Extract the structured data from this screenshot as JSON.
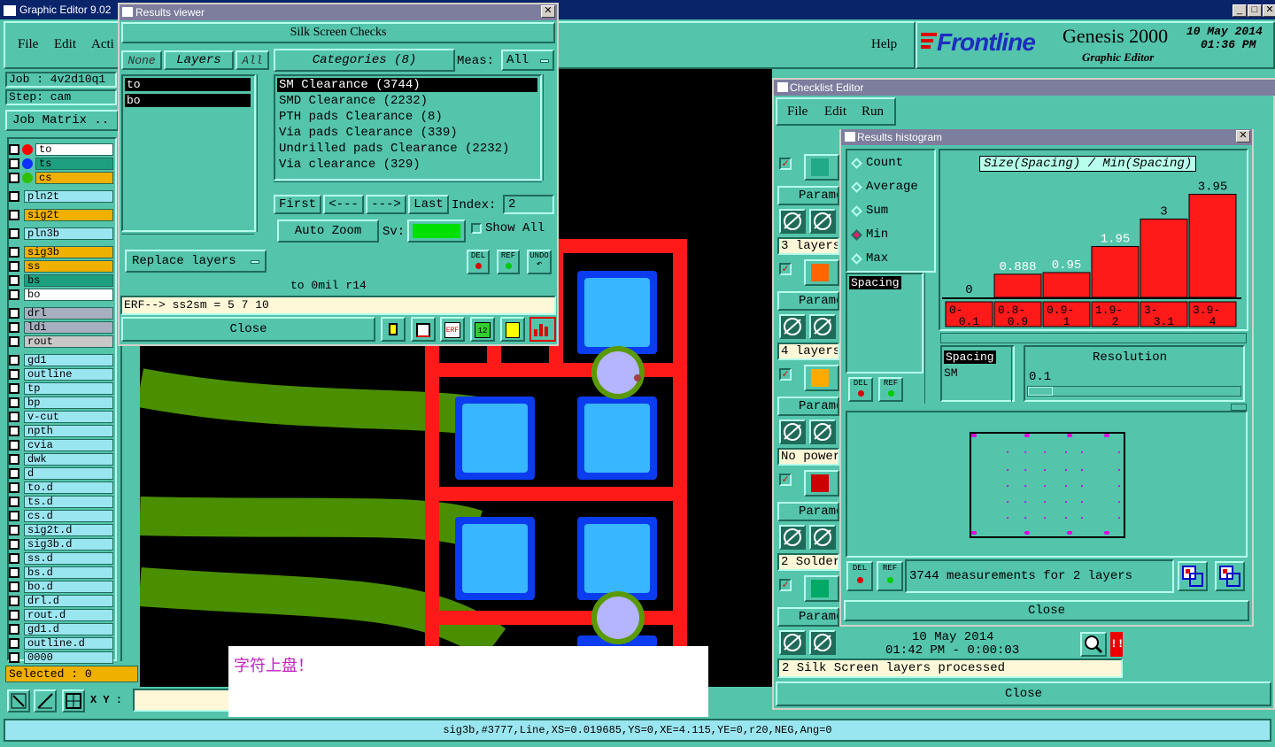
{
  "ge": {
    "title": "Graphic Editor 9.02",
    "menu": [
      "File",
      "Edit",
      "Acti"
    ],
    "help": "Help",
    "job_label": "Job : 4v2d10q1",
    "step_label": "Step: cam",
    "job_matrix": "Job Matrix ..",
    "brand": "Frontline",
    "product": "Genesis 2000",
    "product_sub": "Graphic Editor",
    "date": "10 May 2014",
    "time": "01:36 PM",
    "selected": "Selected : 0",
    "xy_label": "X Y :",
    "status_bar": "sig3b,#3777,Line,XS=0.019685,YS=0,XE=4.115,YE=0,r20,NEG,Ang=0",
    "layers": [
      "to",
      "ts",
      "cs",
      "pln2t",
      "sig2t",
      "pln3b",
      "sig3b",
      "ss",
      "bs",
      "bo",
      "drl",
      "ldi",
      "rout",
      "gd1",
      "outline",
      "tp",
      "bp",
      "v-cut",
      "npth",
      "cvia",
      "dwk",
      "d",
      "to.d",
      "ts.d",
      "cs.d",
      "sig2t.d",
      "sig3b.d",
      "ss.d",
      "bs.d",
      "bo.d",
      "drl.d",
      "rout.d",
      "gd1.d",
      "outline.d",
      "0000"
    ],
    "note": "字符上盘！"
  },
  "rv": {
    "title": "Results viewer",
    "header": "Silk Screen Checks",
    "none": "None",
    "layers_label": "Layers",
    "all": "All",
    "categories": "Categories (8)",
    "meas_label": "Meas:",
    "meas_value": "All",
    "layer_list": [
      "to",
      "bo"
    ],
    "category_list": [
      "SM Clearance (3744)",
      "SMD Clearance (2232)",
      "PTH pads Clearance (8)",
      "Via pads Clearance (339)",
      "Undrilled pads Clearance (2232)",
      "Via clearance (329)"
    ],
    "first": "First",
    "prev": "<---",
    "next": "--->",
    "last": "Last",
    "index_label": "Index:",
    "index_value": "2",
    "auto_zoom": "Auto Zoom",
    "sv_label": "Sv:",
    "show_all": "Show All",
    "replace_layers": "Replace layers",
    "del": "DEL",
    "ref": "REF",
    "undo": "UNDO",
    "info_line": "to  0mil   r14",
    "erf_line": "ERF--> ss2sm = 5 7 10",
    "close": "Close"
  },
  "ce": {
    "title": "Checklist Editor",
    "menu": [
      "File",
      "Edit",
      "Run"
    ],
    "param": "Parame",
    "rows": [
      "3 layers",
      "4 layers",
      "No power",
      "2 Solder",
      "2 Silk Screen layers processed"
    ],
    "date": "10 May 2014",
    "time_line": "01:42 PM - 0:00:03",
    "close": "Close"
  },
  "rh": {
    "title": "Results histogram",
    "options": [
      "Count",
      "Average",
      "Sum",
      "Min",
      "Max"
    ],
    "selected_option": "Min",
    "list_item": "Spacing",
    "res_list": [
      "Spacing",
      "SM"
    ],
    "resolution_label": "Resolution",
    "resolution_value": "0.1",
    "summary": "3744 measurements for 2 layers",
    "close": "Close",
    "del": "DEL",
    "ref": "REF"
  },
  "chart_data": {
    "type": "bar",
    "title": "Size(Spacing) / Min(Spacing)",
    "categories": [
      "0-0.1",
      "0.8-0.9",
      "0.9-1",
      "1.9-2",
      "3-3.1",
      "3.9-4"
    ],
    "values": [
      0,
      0.888,
      0.95,
      1.95,
      3,
      3.95
    ],
    "labels": [
      "0",
      "0.888",
      "0.95",
      "1.95",
      "3",
      "3.95"
    ],
    "bar_color": "#ff1a1a",
    "ylim": [
      0,
      4
    ]
  }
}
